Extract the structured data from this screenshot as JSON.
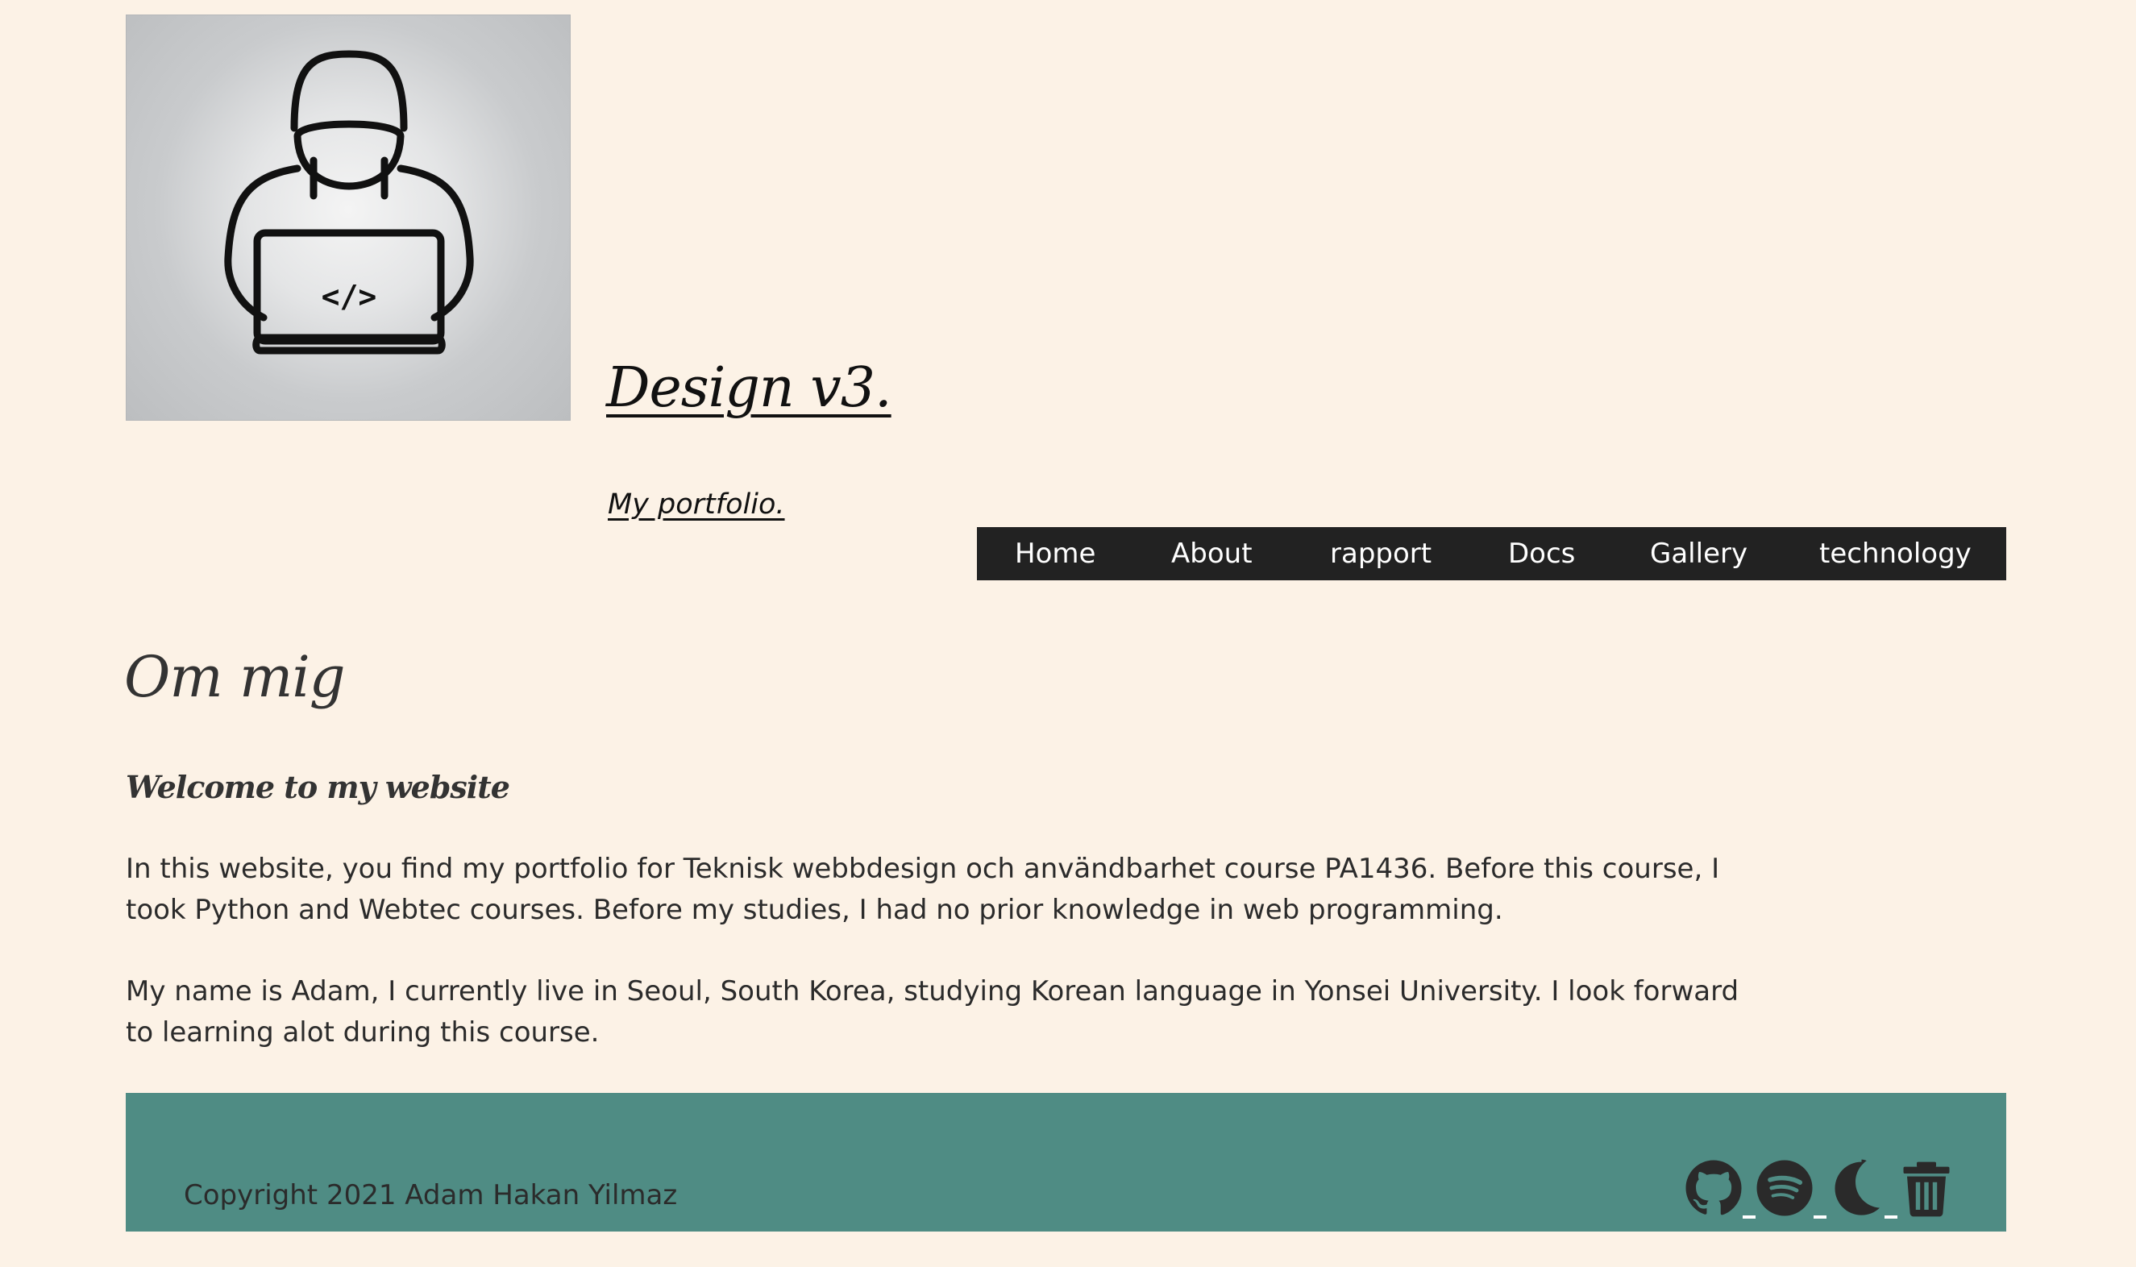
{
  "header": {
    "logo_icon": "hooded-coder-laptop-icon",
    "logo_code_text": "</>",
    "title": "Design v3.",
    "tagline": "My portfolio."
  },
  "nav": {
    "items": [
      {
        "label": "Home"
      },
      {
        "label": "About"
      },
      {
        "label": "rapport"
      },
      {
        "label": "Docs"
      },
      {
        "label": "Gallery"
      },
      {
        "label": "technology"
      }
    ]
  },
  "main": {
    "heading": "Om mig",
    "subheading": "Welcome to my website",
    "paragraphs": [
      "In this website, you find my portfolio for Teknisk webbdesign och användbarhet course PA1436. Before this course, I took Python and Webtec courses. Before my studies, I had no prior knowledge in web programming.",
      "My name is Adam, I currently live in Seoul, South Korea, studying Korean language in Yonsei University. I look forward to learning alot during this course."
    ]
  },
  "footer": {
    "copyright": "Copyright 2021 Adam Hakan Yilmaz",
    "icons": [
      "github-icon",
      "spotify-icon",
      "moon-icon",
      "trash-icon"
    ]
  },
  "colors": {
    "background": "#fcf2e6",
    "nav_background": "#222222",
    "nav_text": "#ffffff",
    "footer_background": "#4f8c84",
    "text": "#2b2b2b"
  }
}
